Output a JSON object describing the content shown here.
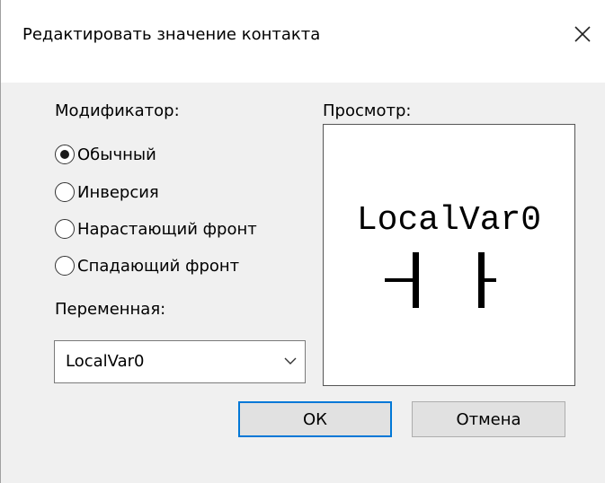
{
  "dialog": {
    "title": "Редактировать значение контакта",
    "close_symbol": "close-icon"
  },
  "modifier": {
    "label": "Модификатор:",
    "options": [
      {
        "label": "Обычный",
        "checked": true
      },
      {
        "label": "Инверсия",
        "checked": false
      },
      {
        "label": "Нарастающий фронт",
        "checked": false
      },
      {
        "label": "Спадающий фронт",
        "checked": false
      }
    ]
  },
  "variable": {
    "label": "Переменная:",
    "selected": "LocalVar0",
    "dropdown_icon": "chevron-down-icon"
  },
  "preview": {
    "label": "Просмотр:",
    "variable_name": "LocalVar0",
    "symbol": "normally-open-contact-icon"
  },
  "buttons": {
    "ok_label": "ОК",
    "cancel_label": "Отмена"
  },
  "colors": {
    "dialog_background": "#f0f0f0",
    "default_button_border": "#0078d7"
  }
}
